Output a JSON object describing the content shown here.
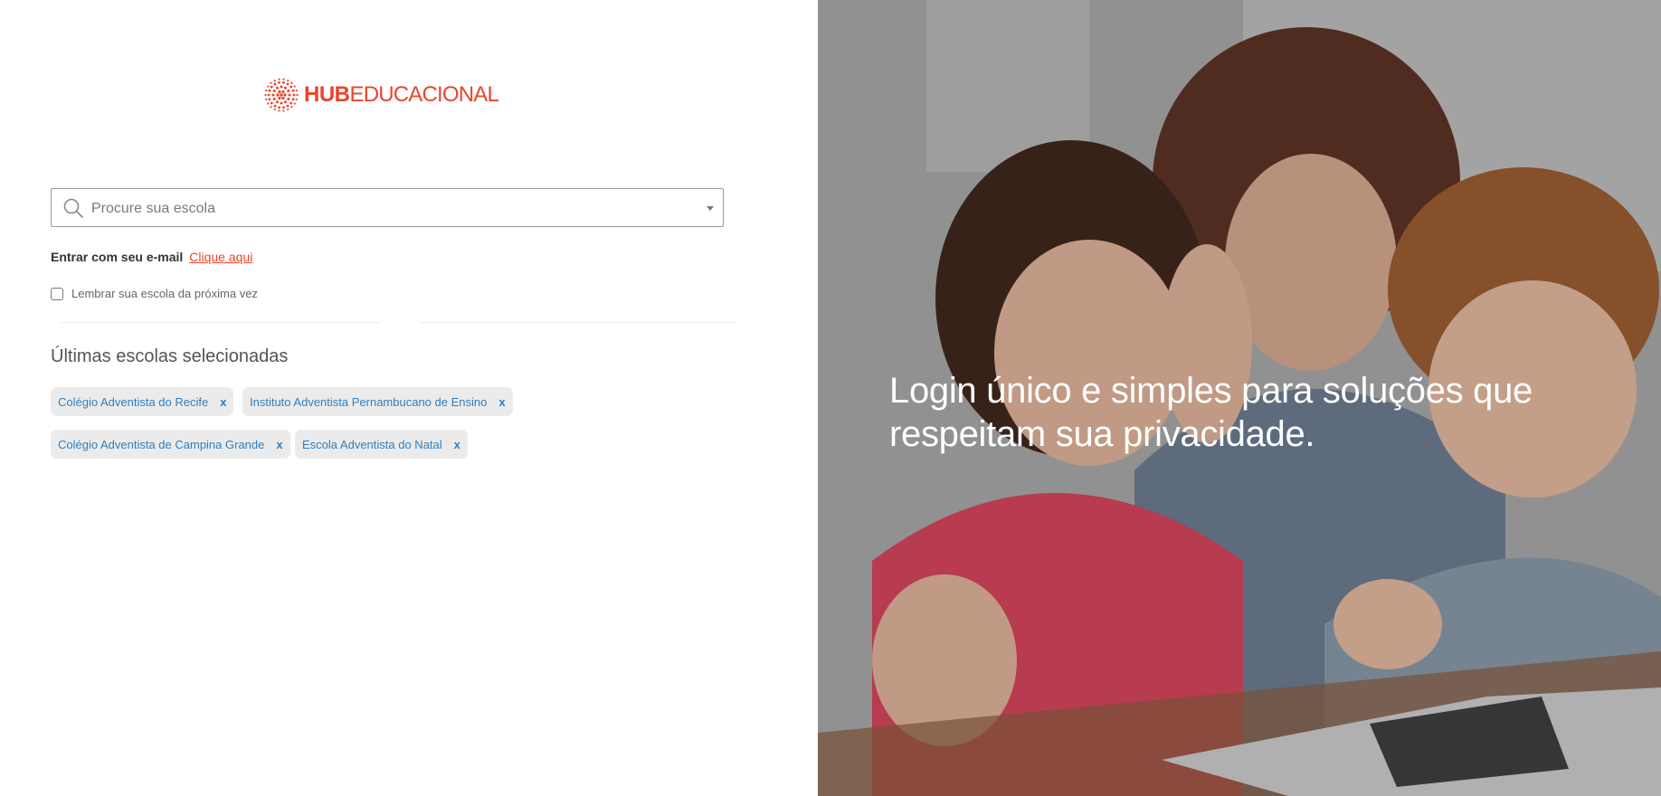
{
  "brand": {
    "logo_icon": "sunburst-dots-icon",
    "hub": "HUB",
    "educacional": "EDUCACIONAL",
    "color": "#e8452c"
  },
  "search": {
    "placeholder": "Procure sua escola",
    "value": "",
    "icon": "search-icon",
    "dropdown_icon": "caret-down-icon"
  },
  "login_email": {
    "label": "Entrar com seu e-mail",
    "link": "Clique aqui"
  },
  "remember": {
    "label": "Lembrar sua escola da próxima vez",
    "checked": false
  },
  "recent": {
    "title": "Últimas escolas selecionadas",
    "schools": [
      {
        "name": "Colégio Adventista do Recife",
        "remove": "x"
      },
      {
        "name": "Instituto Adventista Pernambucano de Ensino",
        "remove": "x"
      },
      {
        "name": "Colégio Adventista de Campina Grande",
        "remove": "x"
      },
      {
        "name": "Escola Adventista do Natal",
        "remove": "x"
      }
    ]
  },
  "hero": {
    "tagline": "Login único e simples para soluções que respeitam sua privacidade.",
    "image": "family-using-laptop-photo"
  },
  "colors": {
    "accent": "#e8452c",
    "chip_text": "#2f7fbf",
    "chip_bg": "#ebebeb"
  }
}
